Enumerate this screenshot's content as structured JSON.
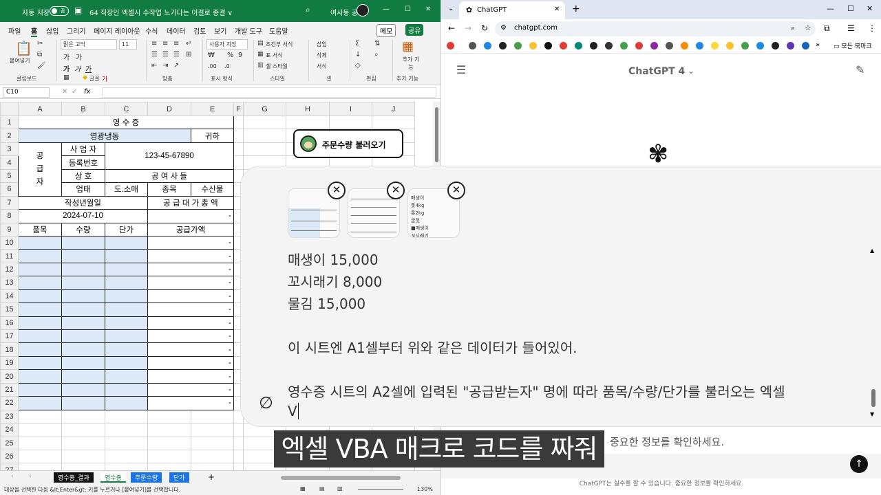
{
  "excel": {
    "autosave_label": "자동 저장",
    "autosave_state": "끔",
    "doc_title": "64 직장인 엑셀시 수작업 노가다는 이걸로 종결 ∨",
    "user_name": "여사동 공",
    "menu_tabs": [
      "파일",
      "홈",
      "삽입",
      "그리기",
      "페이지 레이아웃",
      "수식",
      "데이터",
      "검토",
      "보기",
      "개발 도구",
      "도움말"
    ],
    "memo_label": "메모",
    "share_label": "공유",
    "ribbon": {
      "paste": "붙여넣기",
      "clipboard": "클립보드",
      "font_name": "맑은 고딕",
      "font_size": "11",
      "font_group": "글꼴",
      "align_group": "맞춤",
      "number_format": "사용자 지정",
      "number_group": "표시 형식",
      "cond_format": "조건부 서식",
      "table_format": "표 서식",
      "cell_style": "셀 스타일",
      "style_group": "스타일",
      "insert": "삽입",
      "delete": "삭제",
      "format": "서식",
      "cell_group": "셀",
      "edit_group": "편집",
      "addin": "추가 기능",
      "addin_group": "추가 기능"
    },
    "namebox": "C10",
    "fx": "fx",
    "col_headers": [
      "A",
      "B",
      "C",
      "D",
      "E",
      "F",
      "G",
      "H",
      "I",
      "J"
    ],
    "row_headers": [
      "1",
      "2",
      "3",
      "4",
      "5",
      "6",
      "7",
      "8",
      "9",
      "10",
      "11",
      "12",
      "13",
      "14",
      "15",
      "16",
      "17",
      "18",
      "19",
      "20",
      "21",
      "22",
      "23",
      "24",
      "25",
      "26",
      "27"
    ],
    "receipt": {
      "title": "영        수        증",
      "recipient": "영광냉동",
      "honorific": "귀하",
      "supplier": "공\n급\n자",
      "bizno_label1": "사 업 자",
      "bizno_label2": "등록번호",
      "bizno": "123-45-67890",
      "trade_label": "상 호",
      "trade_name": "공 여 사 들",
      "biztype_label": "업태",
      "biztype": "도.소매",
      "item_label": "종목",
      "item": "수산물",
      "date_label": "작성년월일",
      "total_label": "공 급 대 가 총 액",
      "date": "2024-07-10",
      "total": "-",
      "col_item": "품목",
      "col_qty": "수량",
      "col_price": "단가",
      "col_amount": "공급가액",
      "dash": "-"
    },
    "macro_button": "주문수량 불러오기",
    "sheets": [
      "영수증_결과",
      "영수증",
      "주문수량",
      "단가"
    ],
    "status_text": "대상을 선택한 다음 &lt;Enter&gt; 키를 누르거나 [붙여넣기]를 선택합니다.",
    "zoom": "130%"
  },
  "chrome": {
    "tab_title": "ChatGPT",
    "url": "chatgpt.com",
    "bookmarks_label": "모든 북마크",
    "model": "ChatGPT 4",
    "footer": "ChatGPT는 실수를 할 수 있습니다. 중요한 정보를 확인하세요.",
    "footer_partial": "중요한 정보를 확인하세요."
  },
  "chat": {
    "lines": [
      {
        "text": "매생이    15,000"
      },
      {
        "text": "꼬시래기 8,000"
      },
      {
        "text": "물김   15,000"
      },
      {
        "text": "이 시트엔 A1셀부터 위와 같은 데이터가 들어있어."
      },
      {
        "text": "영수증 시트의 A2셀에 입력된 \"공급받는자\" 명에 따라 품목/수량/단가를 불러오는 엑셀"
      },
      {
        "text": "V"
      }
    ],
    "thumb3_rows": [
      "매생이",
      "톳4kg",
      "톳2kg",
      "굴젓",
      "■매생이",
      "꼬시래기"
    ]
  },
  "caption": "엑셀 VBA 매크로 코드를 짜줘",
  "colors": {
    "excel_green": "#107c41",
    "selected_fill": "#dde9f6"
  }
}
